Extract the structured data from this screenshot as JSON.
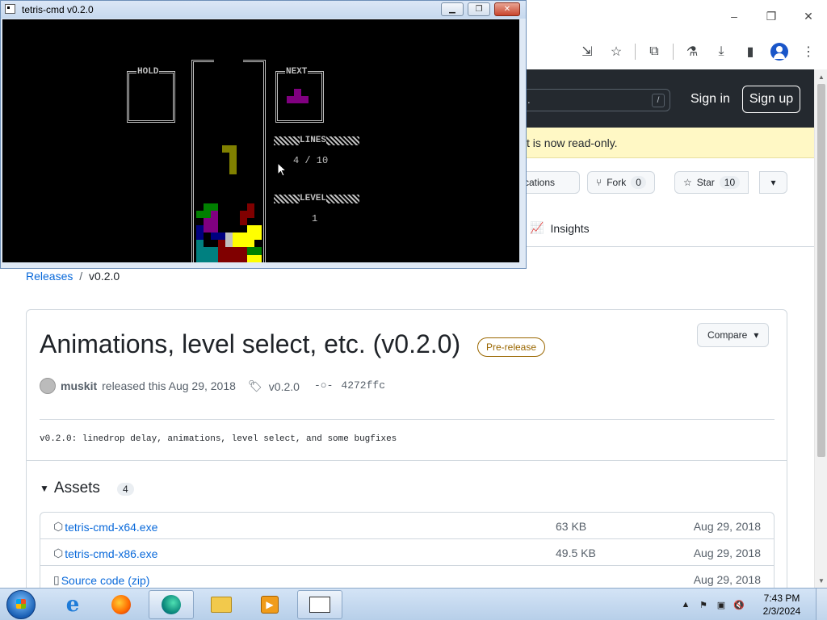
{
  "browser": {
    "window_controls": [
      "–",
      "❐",
      "✕"
    ],
    "toolbar_icons": [
      "install-app-icon",
      "bookmark-star-icon",
      "extensions-icon",
      "labs-icon",
      "download-icon",
      "sidepanel-icon",
      "profile-icon",
      "menu-icon"
    ],
    "github": {
      "search_slash": "/",
      "search_partial": "..",
      "sign_in": "Sign in",
      "sign_up": "Sign up",
      "banner": "t is now read-only.",
      "notifications_label": "tifications",
      "fork_label": "Fork",
      "fork_count": "0",
      "star_label": "Star",
      "star_count": "10",
      "insights_tab": "Insights",
      "breadcrumb": {
        "releases": "Releases",
        "sep": "/",
        "current": "v0.2.0"
      },
      "release": {
        "title": "Animations, level select, etc. (v0.2.0)",
        "badge": "Pre-release",
        "compare": "Compare",
        "author": "muskit",
        "released_text": "released this Aug 29, 2018",
        "tag": "v0.2.0",
        "commit": "4272ffc",
        "body": "v0.2.0: linedrop delay, animations, level select, and some bugfixes",
        "assets_title": "Assets",
        "assets_count": "4",
        "assets": [
          {
            "name": "tetris-cmd-x64.exe",
            "size": "63 KB",
            "date": "Aug 29, 2018"
          },
          {
            "name": "tetris-cmd-x86.exe",
            "size": "49.5 KB",
            "date": "Aug 29, 2018"
          },
          {
            "name": "Source code (zip)",
            "size": "",
            "date": "Aug 29, 2018"
          }
        ]
      }
    },
    "colors": {
      "header": "#24292f",
      "link": "#0969da",
      "banner": "#fff8c5",
      "prerelease": "#9a6700"
    }
  },
  "console": {
    "title": "tetris-cmd v0.2.0",
    "hold_label": "HOLD",
    "next_label": "NEXT",
    "lines_label": "LINES",
    "lines_value": "4 / 10",
    "level_label": "LEVEL",
    "level_value": "1",
    "colors": {
      "next_piece": "#800080",
      "active_piece": "#808000"
    }
  },
  "taskbar": {
    "apps": [
      "internet-explorer",
      "firefox",
      "edge",
      "file-explorer",
      "media-player",
      "console"
    ],
    "time": "7:43 PM",
    "date": "2/3/2024"
  }
}
